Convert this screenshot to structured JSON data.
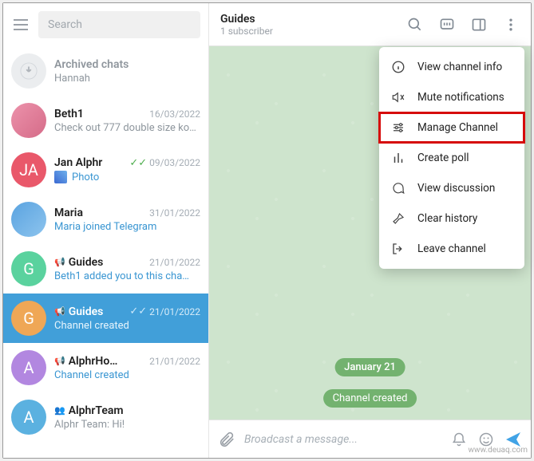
{
  "window": {
    "minimize": "—",
    "maximize": "☐",
    "close": "✕"
  },
  "sidebar": {
    "search_placeholder": "Search",
    "chats": [
      {
        "name": "Archived chats",
        "preview": "Hannah",
        "date": ""
      },
      {
        "name": "Beth1",
        "preview": "Check out 777 double size ko…",
        "date": "16/03/2022"
      },
      {
        "name": "Jan Alphr",
        "preview": "Photo",
        "date": "09/03/2022",
        "checks": "✓✓"
      },
      {
        "name": "Maria",
        "preview": "Maria joined Telegram",
        "date": "31/01/2022"
      },
      {
        "name": "Guides",
        "preview": "Beth1 added you to this cha…",
        "date": "21/01/2022"
      },
      {
        "name": "Guides",
        "preview": "Channel created",
        "date": "21/01/2022",
        "checks": "✓✓"
      },
      {
        "name": "AlphrHo…",
        "preview": "Channel created",
        "date": "21/01/2022"
      },
      {
        "name": "AlphrTeam",
        "preview": "Alphr Team: Hi!",
        "date": ""
      }
    ]
  },
  "header": {
    "title": "Guides",
    "subtitle": "1 subscriber"
  },
  "menu": {
    "items": [
      "View channel info",
      "Mute notifications",
      "Manage Channel",
      "Create poll",
      "View discussion",
      "Clear history",
      "Leave channel"
    ]
  },
  "chatArea": {
    "date_badge": "January 21",
    "system_msg": "Channel created"
  },
  "footer": {
    "placeholder": "Broadcast a message..."
  },
  "watermark": "www.deuaq.com"
}
